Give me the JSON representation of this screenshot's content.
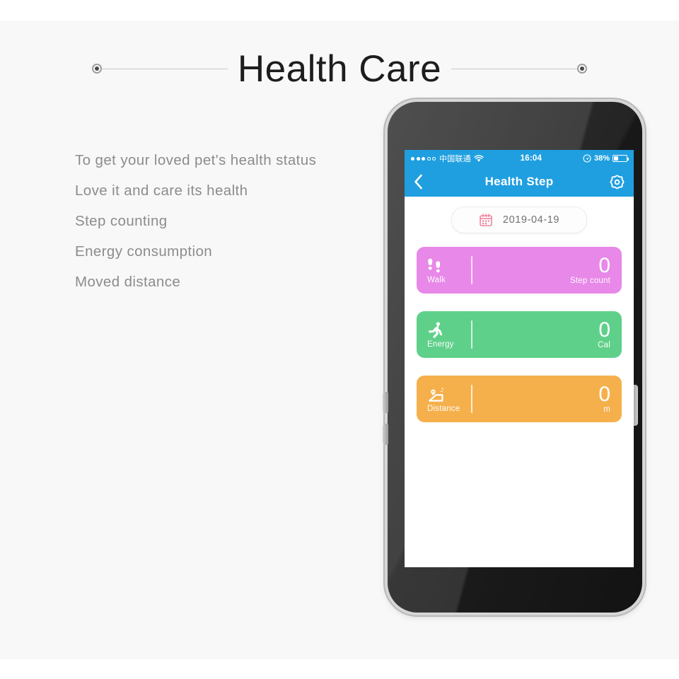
{
  "header": {
    "title": "Health Care",
    "left_dot": "decorative-dot",
    "right_dot": "decorative-dot"
  },
  "features": [
    "To get your loved pet's health status",
    "Love it and care its health",
    "Step counting",
    "Energy consumption",
    "Moved distance"
  ],
  "phone": {
    "status_bar": {
      "signal_filled": 3,
      "signal_hollow": 2,
      "carrier": "中国联通",
      "wifi": "wifi-icon",
      "time": "16:04",
      "location": "location-icon",
      "battery_percent": "38%",
      "battery_level": 38
    },
    "nav": {
      "back": "back-chevron-icon",
      "title": "Health Step",
      "settings": "gear-icon"
    },
    "date_picker": {
      "icon": "calendar-icon",
      "value": "2019-04-19"
    },
    "cards": [
      {
        "name": "Walk",
        "icon": "footprints-icon",
        "value": "0",
        "unit": "Step count",
        "color": "#e888e8"
      },
      {
        "name": "Energy",
        "icon": "running-icon",
        "value": "0",
        "unit": "Cal",
        "color": "#5fd08a"
      },
      {
        "name": "Distance",
        "icon": "map-pin-icon",
        "value": "0",
        "unit": "m",
        "color": "#f5b04c"
      }
    ]
  },
  "colors": {
    "accent_blue": "#1f9fe0",
    "page_bg": "#f8f8f8",
    "text_gray": "#8c8c8c",
    "calendar_pink": "#f2839b"
  }
}
